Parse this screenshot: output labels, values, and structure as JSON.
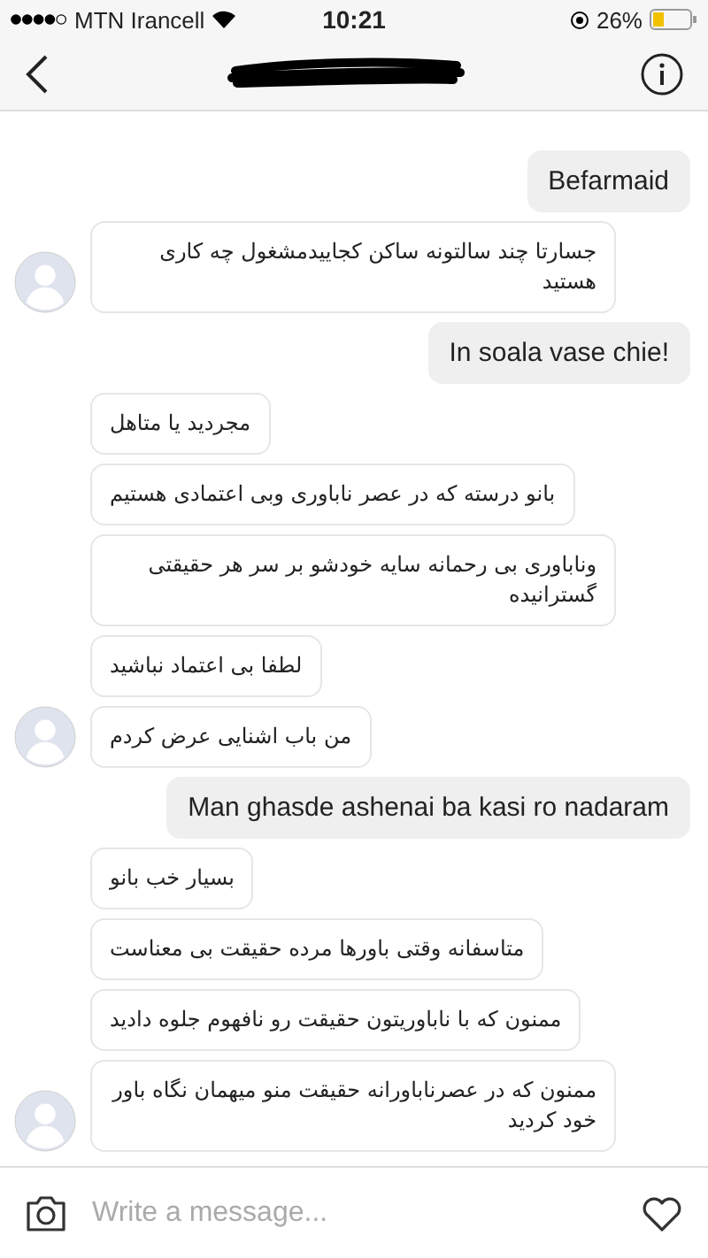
{
  "status_bar": {
    "carrier": "MTN Irancell",
    "time": "10:21",
    "battery": "26%"
  },
  "messages": [
    {
      "kind": "outgoing",
      "text": "Befarmaid",
      "avatar": false
    },
    {
      "kind": "incoming",
      "text": "جسارتا چند سالتونه ساکن کجاییدمشغول چه کاری هستید",
      "avatar": true
    },
    {
      "kind": "outgoing",
      "text": "In soala vase chie!",
      "avatar": false
    },
    {
      "kind": "incoming",
      "text": "مجردید یا متاهل",
      "avatar": false
    },
    {
      "kind": "incoming",
      "text": "بانو درسته که در عصر ناباوری وبی اعتمادی هستیم",
      "avatar": false
    },
    {
      "kind": "incoming",
      "text": "وناباوری بی رحمانه سایه خودشو بر سر هر حقیقتی گسترانیده",
      "avatar": false
    },
    {
      "kind": "incoming",
      "text": "لطفا بی اعتماد نباشید",
      "avatar": false
    },
    {
      "kind": "incoming",
      "text": "من باب اشنایی عرض کردم",
      "avatar": true
    },
    {
      "kind": "outgoing",
      "text": "Man ghasde ashenai ba kasi ro nadaram",
      "avatar": false
    },
    {
      "kind": "incoming",
      "text": "بسیار خب بانو",
      "avatar": false
    },
    {
      "kind": "incoming",
      "text": "متاسفانه وقتی باورها مرده حقیقت بی معناست",
      "avatar": false
    },
    {
      "kind": "incoming",
      "text": "ممنون که با ناباوریتون حقیقت رو نافهوم جلوه دادید",
      "avatar": false
    },
    {
      "kind": "incoming",
      "text": "ممنون که در عصرناباورانه حقیقت منو میهمان نگاه باور خود کردید",
      "avatar": true
    }
  ],
  "composer": {
    "placeholder": "Write a message..."
  }
}
